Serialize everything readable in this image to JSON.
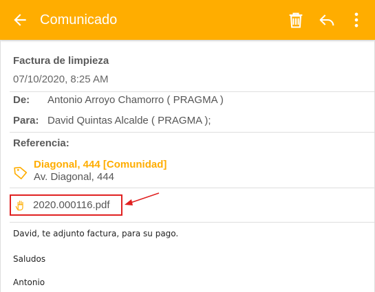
{
  "header": {
    "title": "Comunicado",
    "color": "#ffad00"
  },
  "message": {
    "subject": "Factura de limpieza",
    "date": "07/10/2020, 8:25 AM",
    "from_label": "De:",
    "from_value": "Antonio Arroyo Chamorro ( PRAGMA )",
    "to_label": "Para:",
    "to_value": "David Quintas Alcalde ( PRAGMA );",
    "reference_label": "Referencia:",
    "reference_name": "Diagonal, 444 [Comunidad]",
    "reference_address": "Av. Diagonal, 444",
    "attachment": "2020.000116.pdf",
    "body": [
      "David, te adjunto factura, para su pago.",
      "Saludos",
      "Antonio"
    ]
  },
  "icons": {
    "back": "arrow-left-icon",
    "delete": "trash-icon",
    "reply": "reply-icon",
    "more": "more-vertical-icon",
    "tag": "tag-icon",
    "attachment": "hand-document-icon"
  },
  "annotation_color": "#e02020"
}
